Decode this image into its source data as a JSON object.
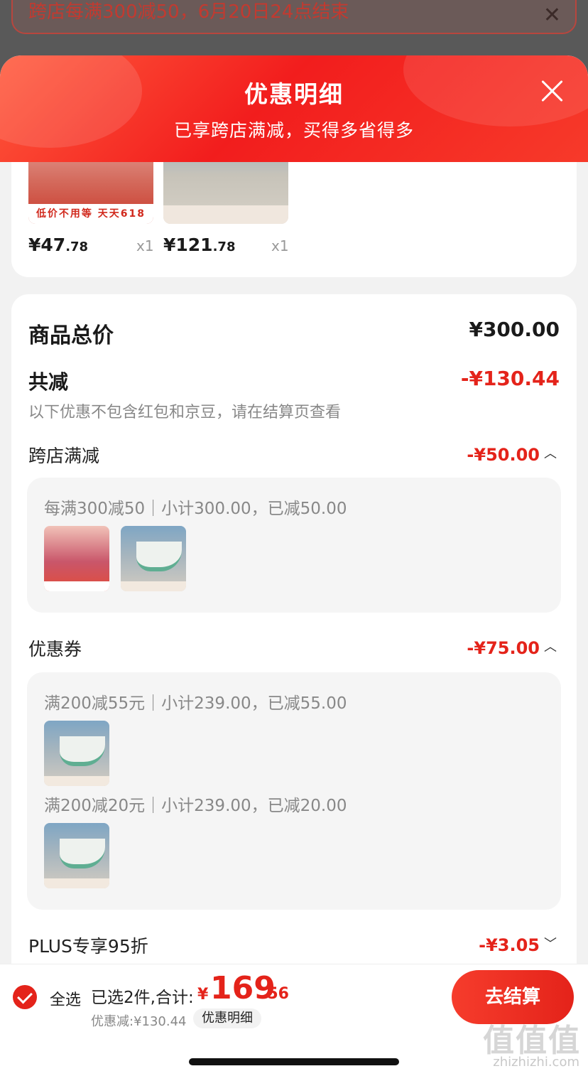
{
  "background": {
    "banner_text": "跨店每满300减50，6月20日24点结束",
    "close_glyph": "✕"
  },
  "sheet": {
    "title": "优惠明细",
    "subtitle": "已享跨店满减，买得多省得多",
    "close_icon": "close-icon"
  },
  "products": [
    {
      "thumb_text": "低价不用等 天天618",
      "price_int": "¥47",
      "price_dec": ".78",
      "qty": "x1"
    },
    {
      "thumb_text": "",
      "price_int": "¥121",
      "price_dec": ".78",
      "qty": "x1"
    }
  ],
  "summary": {
    "total_label": "商品总价",
    "total_value": "¥300.00",
    "reduce_label": "共减",
    "reduce_value": "-¥130.44",
    "note": "以下优惠不包含红包和京豆，请在结算页查看",
    "sections": [
      {
        "label": "跨店满减",
        "value": "-¥50.00",
        "lines": [
          "每满300减50｜小计300.00，已减50.00"
        ]
      },
      {
        "label": "优惠券",
        "value": "-¥75.00",
        "lines": [
          "满200减55元｜小计239.00，已减55.00",
          "满200减20元｜小计239.00，已减20.00"
        ]
      },
      {
        "label": "PLUS专享95折",
        "value": "-¥3.05"
      }
    ]
  },
  "bottom": {
    "select_all": "全选",
    "selected_text": "已选2件,合计:",
    "total_symbol": "¥",
    "total_int": "169",
    "total_dec": ".56",
    "discount_text": "优惠减:¥130.44",
    "detail_chip": "优惠明细",
    "checkout": "去结算"
  },
  "watermark": {
    "text": "值值值",
    "url": "zhizhizhi.com"
  },
  "colors": {
    "accent": "#e4231a",
    "header_gradient_start": "#ff5a3c",
    "muted": "#888888"
  }
}
